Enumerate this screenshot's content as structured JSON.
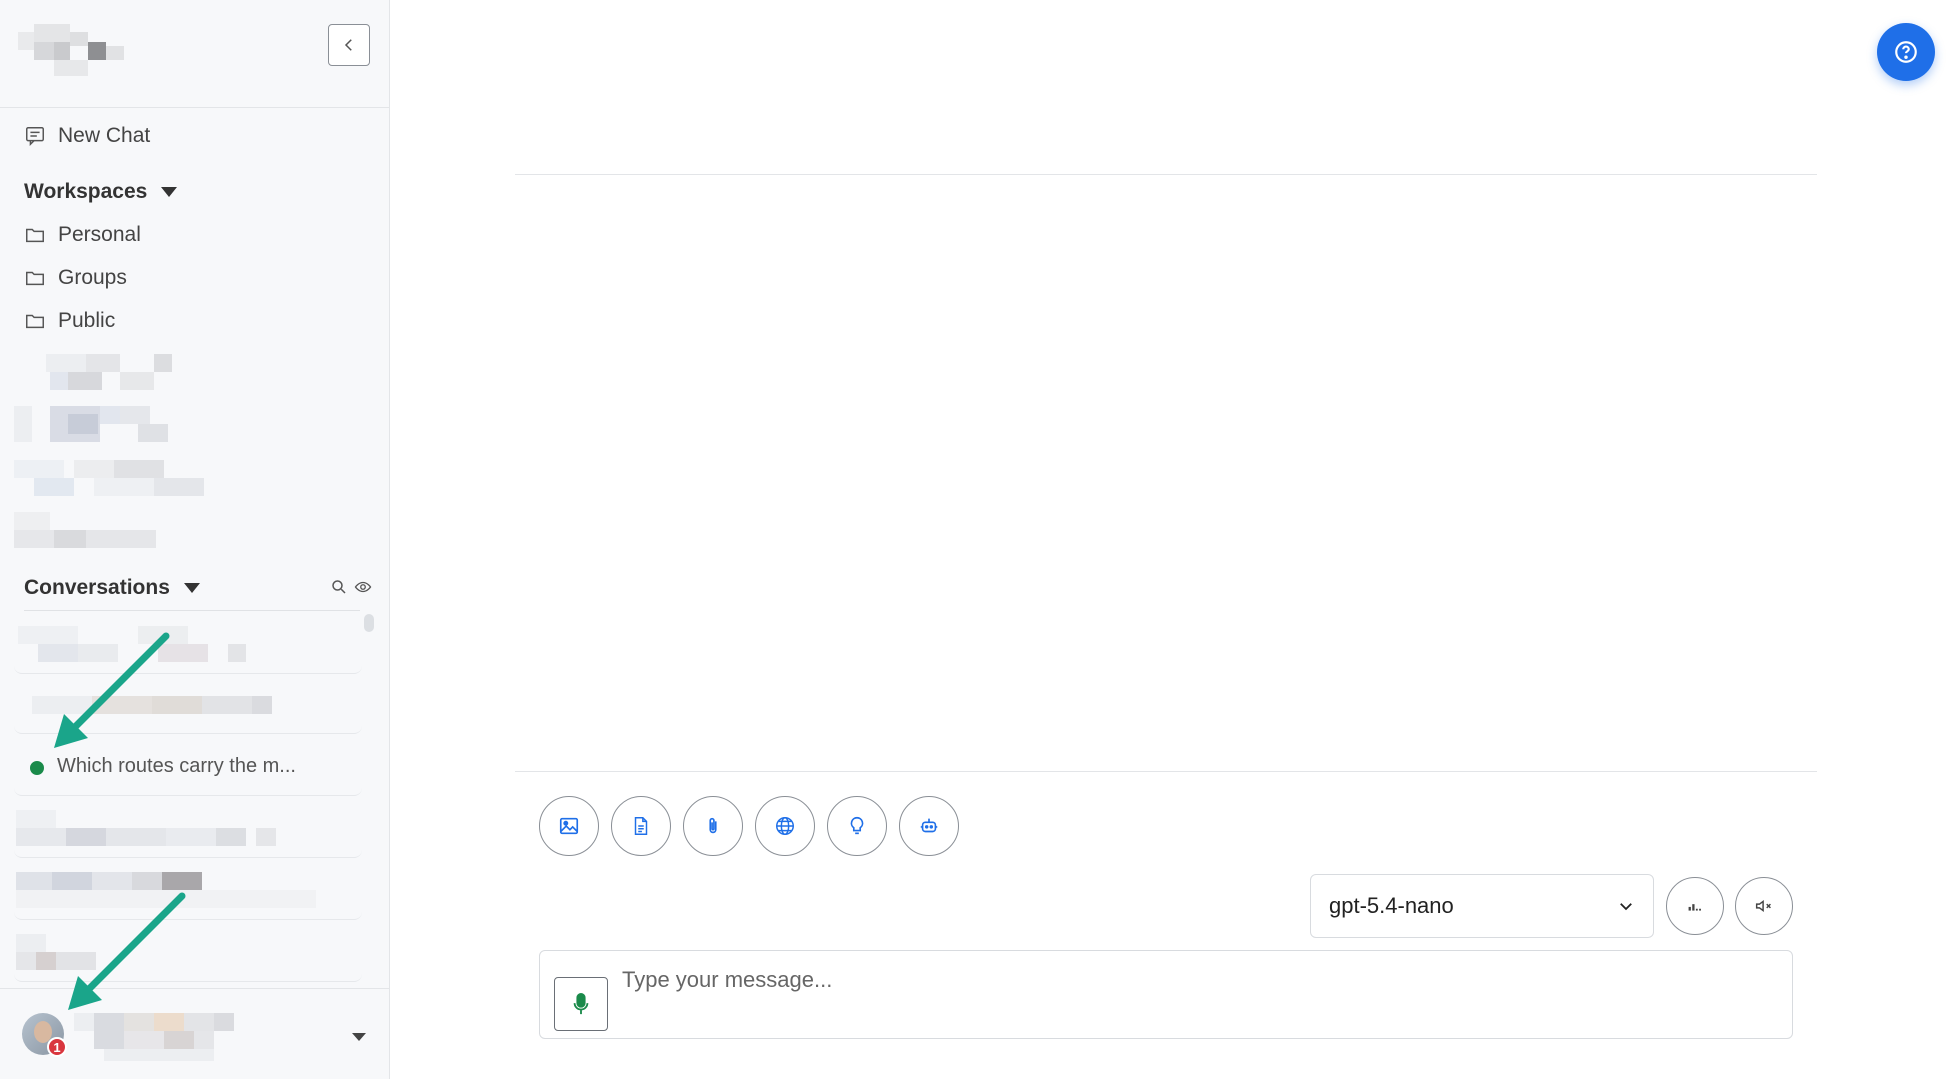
{
  "sidebar": {
    "new_chat_label": "New Chat",
    "workspaces_label": "Workspaces",
    "workspace_items": [
      {
        "label": "Personal"
      },
      {
        "label": "Groups"
      },
      {
        "label": "Public"
      }
    ],
    "conversations_label": "Conversations",
    "conversation_items": [
      {
        "title": "",
        "redacted": true
      },
      {
        "title": "",
        "redacted": true
      },
      {
        "title": "Which routes carry the m...",
        "status": "active"
      },
      {
        "title": "",
        "redacted": true
      },
      {
        "title": "",
        "redacted": true
      },
      {
        "title": "",
        "redacted": true
      }
    ],
    "footer": {
      "notification_count": "1"
    }
  },
  "composer": {
    "model": "gpt-5.4-nano",
    "placeholder": "Type your message...",
    "tools": [
      "image-icon",
      "document-icon",
      "paperclip-icon",
      "globe-icon",
      "lightbulb-icon",
      "robot-icon"
    ]
  },
  "colors": {
    "accent": "#1f6fe8",
    "status_active": "#1a8a4a",
    "badge": "#d9363e",
    "annotation_arrow": "#1aa58a"
  }
}
